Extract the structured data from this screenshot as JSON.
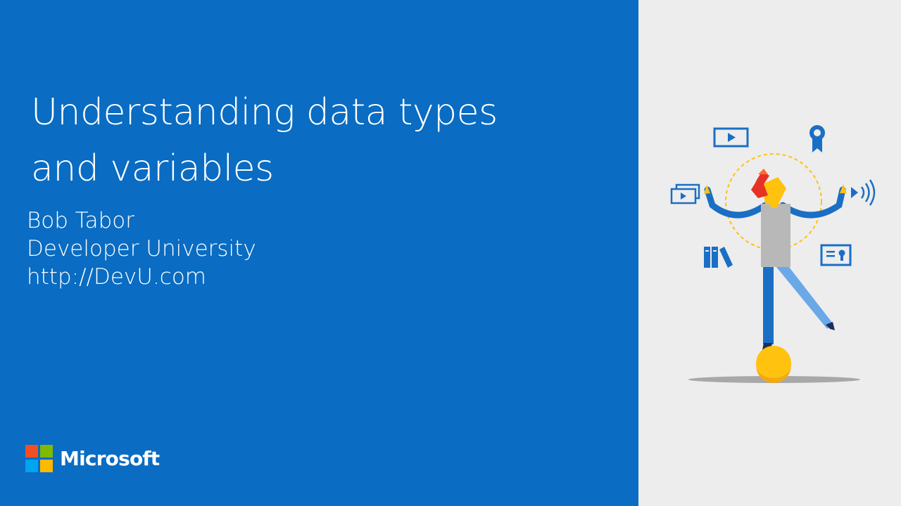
{
  "slide": {
    "title_lines": [
      "Understanding data types",
      "and variables"
    ],
    "presenter_lines": [
      "Bob Tabor",
      "Developer University",
      "http://DevU.com"
    ]
  },
  "brand": {
    "name": "Microsoft",
    "logo_colors": [
      "#f25022",
      "#7fba00",
      "#00a4ef",
      "#ffb900"
    ]
  },
  "colors": {
    "background_blue": "#0a6cc2",
    "right_panel": "#ededed",
    "text": "#ffffff",
    "icon_blue": "#1a6fc4",
    "ball_yellow": "#ffc20e"
  },
  "illustration": {
    "icons": [
      "video-icon",
      "award-ribbon-icon",
      "video-stack-icon",
      "audio-icon",
      "books-icon",
      "certificate-icon"
    ]
  }
}
